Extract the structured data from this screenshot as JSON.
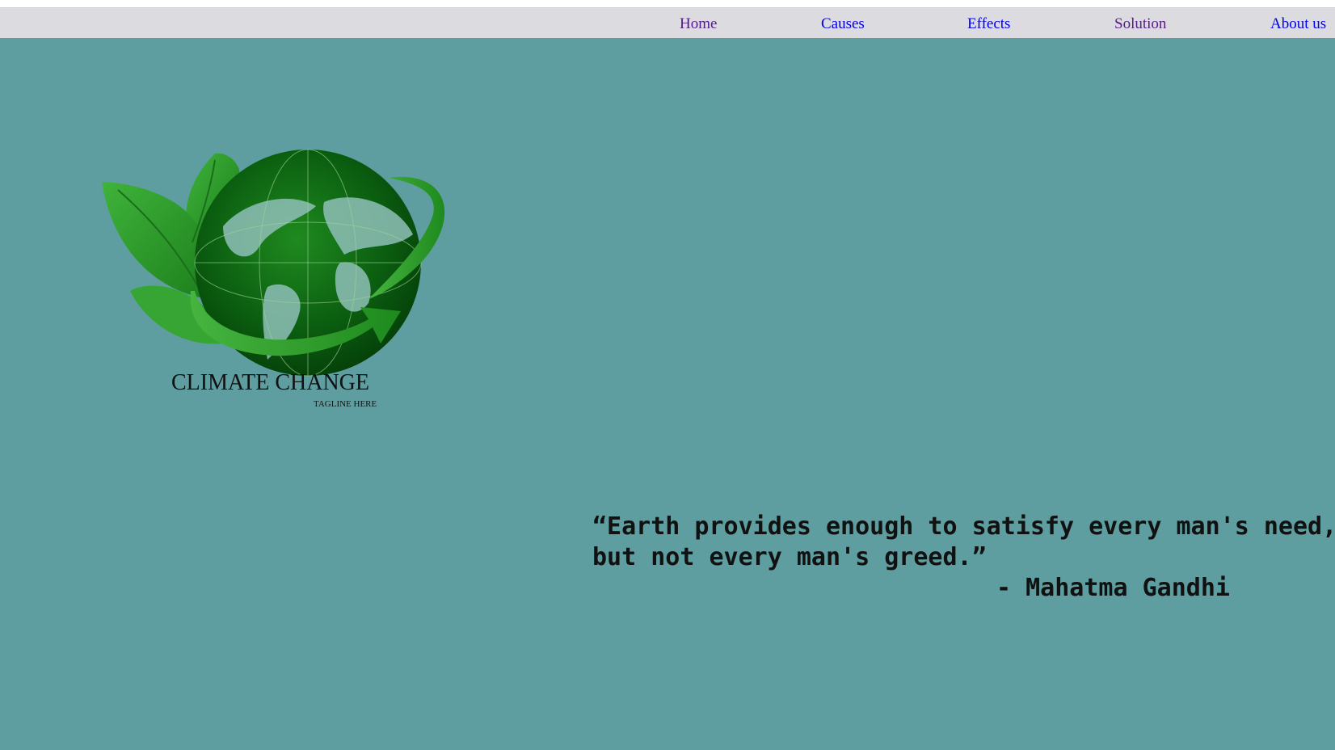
{
  "nav": {
    "items": [
      {
        "label": "Home",
        "state": "visited"
      },
      {
        "label": "Causes",
        "state": "unvisited"
      },
      {
        "label": "Effects",
        "state": "unvisited"
      },
      {
        "label": "Solution",
        "state": "visited"
      },
      {
        "label": "About us",
        "state": "unvisited"
      }
    ]
  },
  "logo": {
    "title": "CLIMATE CHANGE",
    "tagline": "TAGLINE HERE",
    "icon": "globe-with-leaves-and-arrow-icon"
  },
  "quote": {
    "line1": "“Earth provides enough to satisfy every man's need,",
    "line2": "but not every man's greed.”",
    "author": "- Mahatma Gandhi"
  },
  "colors": {
    "background": "#5f9ea0",
    "navbar": "#dcdbdf",
    "visited_link": "#551a8b",
    "link": "#0000ee",
    "text": "#111111"
  }
}
